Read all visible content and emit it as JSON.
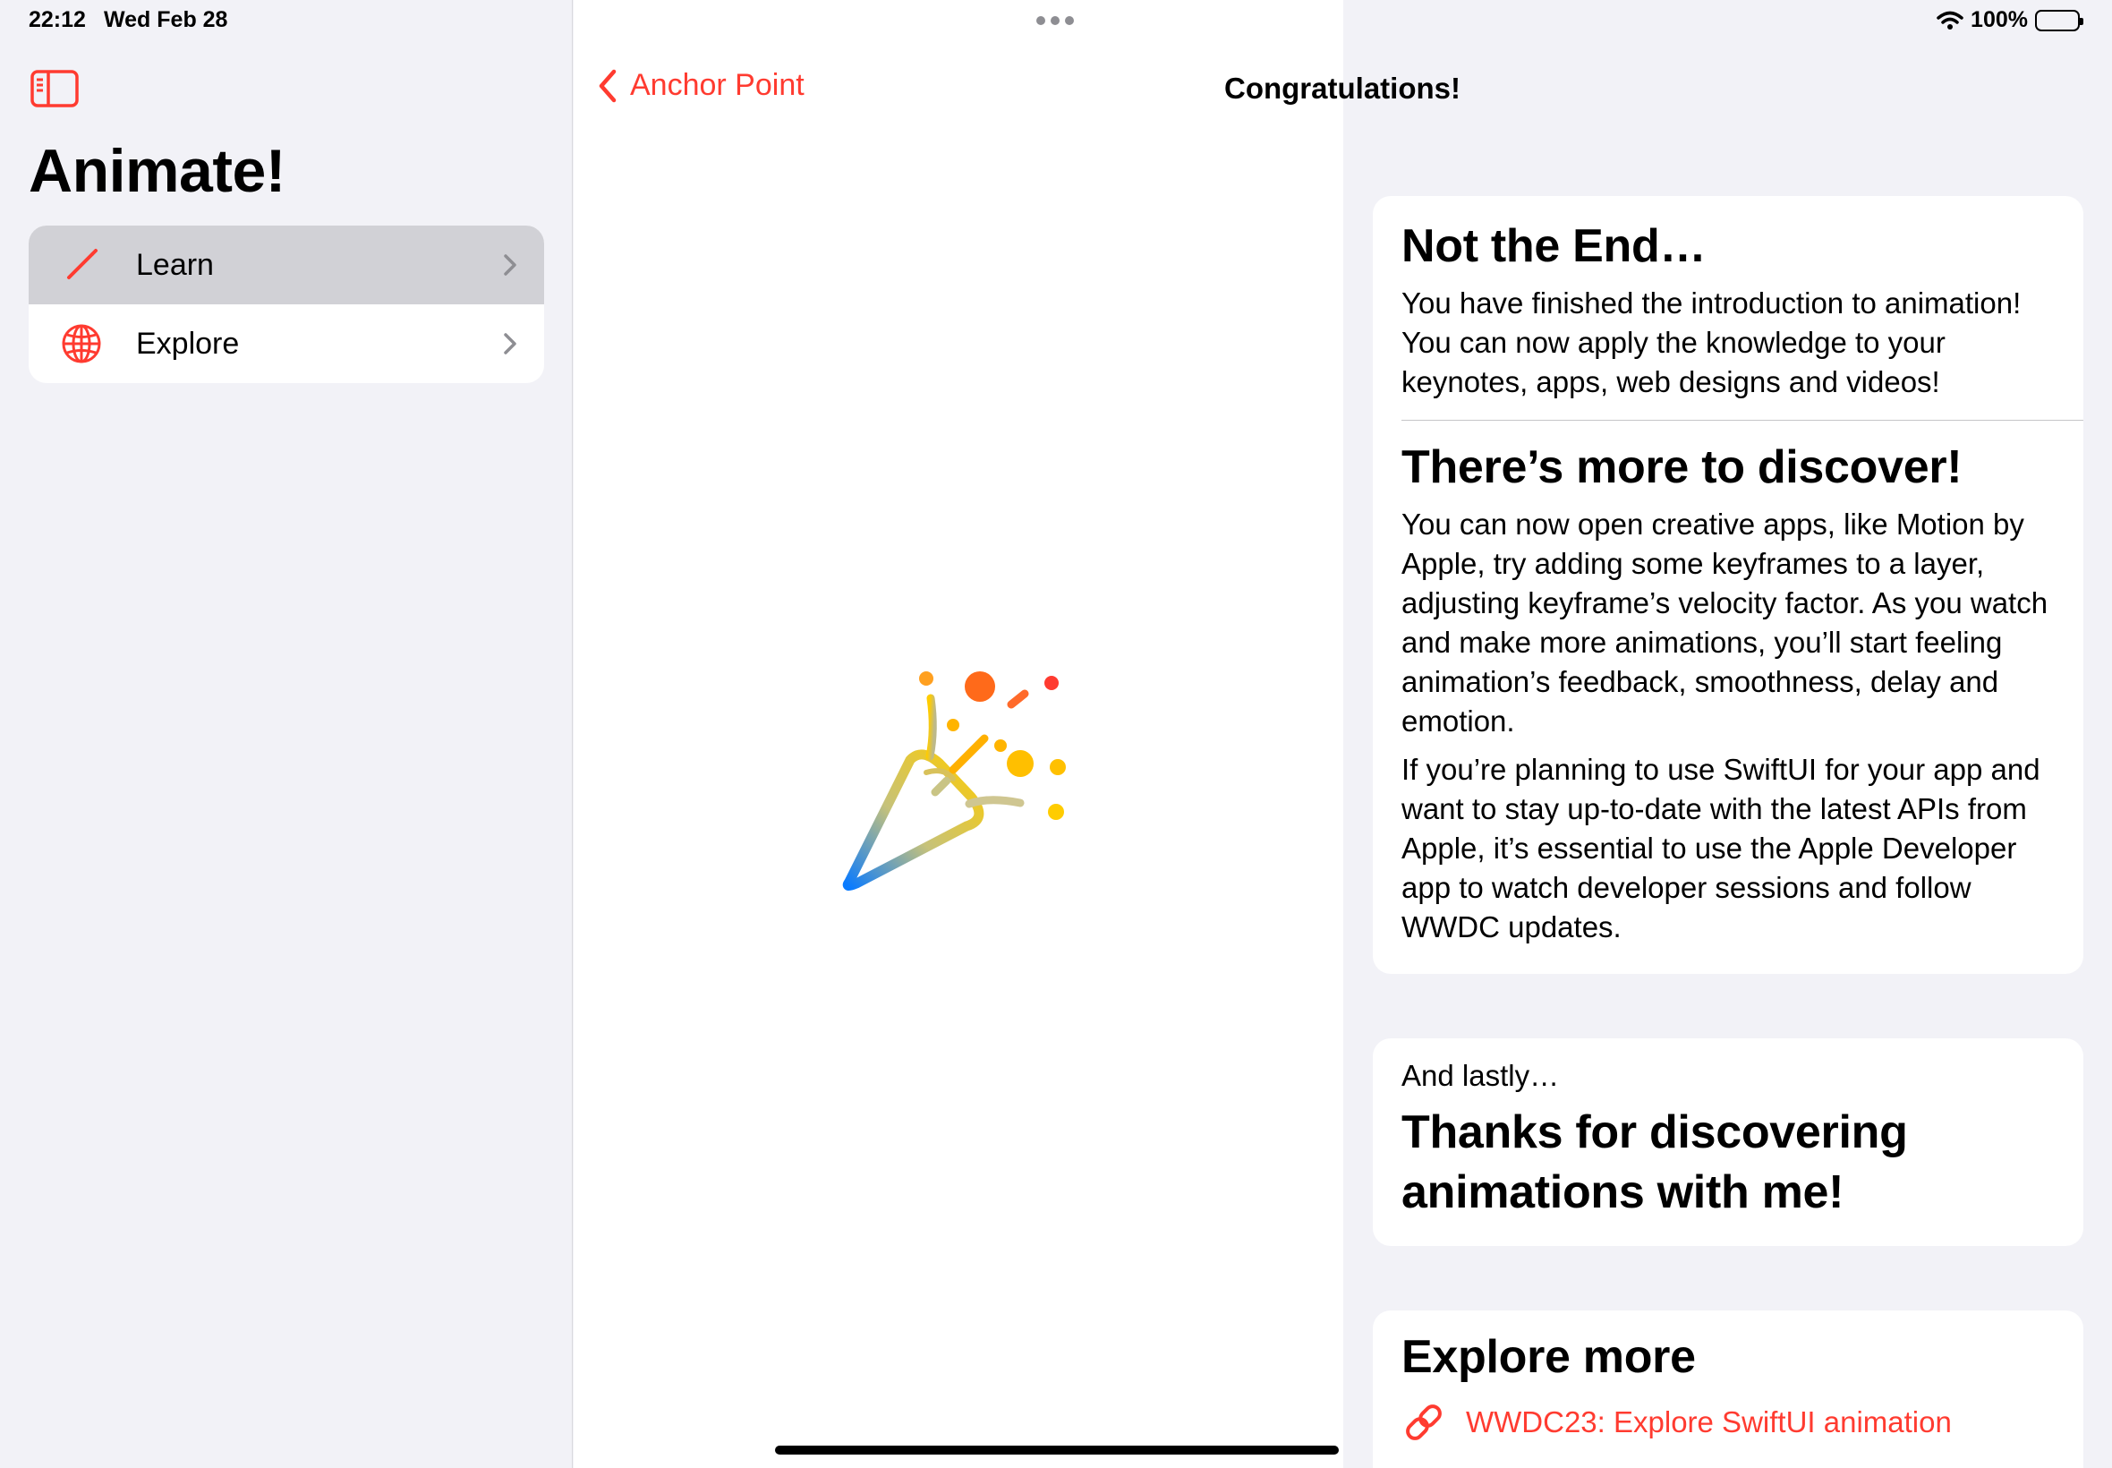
{
  "status_bar": {
    "time": "22:12",
    "date": "Wed Feb 28",
    "battery": "100%",
    "battery_level": 1.0
  },
  "sidebar": {
    "title": "Animate!",
    "items": [
      {
        "label": "Learn",
        "icon": "pencil-icon",
        "selected": true
      },
      {
        "label": "Explore",
        "icon": "globe-icon",
        "selected": false
      }
    ]
  },
  "nav": {
    "back_label": "Anchor Point",
    "title": "Congratulations!"
  },
  "content": {
    "section1_title": "Not the End…",
    "section1_body": "You have finished the introduction to animation! You can now apply the knowledge to your keynotes, apps, web designs and videos!",
    "section2_title": "There’s more to discover!",
    "section2_body1": "You can now open creative apps, like Motion by Apple, try adding some keyframes to a layer, adjusting keyframe’s velocity factor. As you watch and make more animations, you’ll start feeling animation’s feedback, smoothness, delay and emotion.",
    "section2_body2": "If you’re planning to use SwiftUI for your app and want to stay up-to-date with the latest APIs from Apple, it’s essential to use the Apple Developer app to watch developer sessions and follow WWDC updates.",
    "lastly_caption": "And lastly…",
    "lastly_title": "Thanks for discovering animations with me!",
    "explore_title": "Explore more",
    "explore_link": "WWDC23: Explore SwiftUI animation"
  },
  "colors": {
    "accent": "#ff3b30",
    "background": "#f2f2f7",
    "card": "#ffffff",
    "selected_row": "#d1d1d6"
  },
  "icons": {
    "sidebar_toggle": "sidebar-toggle-icon",
    "back": "chevron-left-icon",
    "hero": "party-popper-icon",
    "link": "link-icon"
  }
}
